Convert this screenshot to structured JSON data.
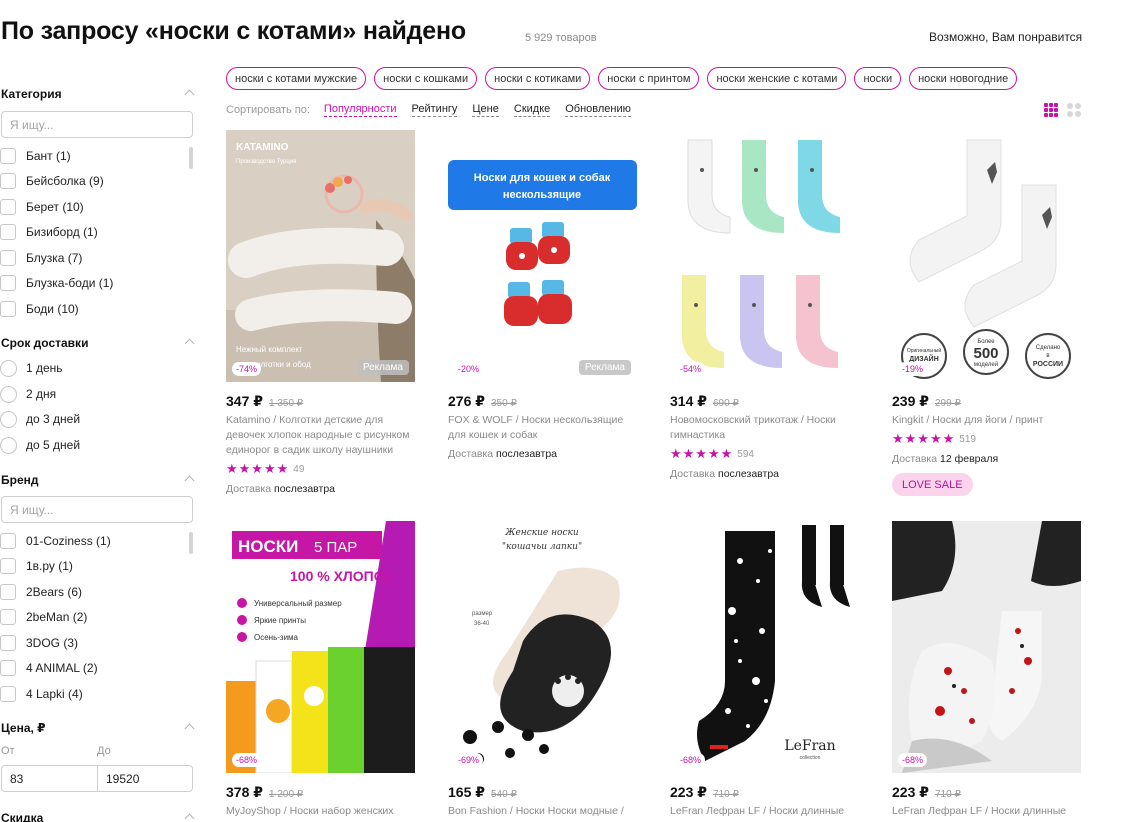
{
  "header": {
    "title": "По запросу «носки с котами» найдено",
    "count": "5 929 товаров",
    "maybe_like": "Возможно, Вам понравится"
  },
  "filters": {
    "category": {
      "title": "Категория",
      "placeholder": "Я ищу...",
      "items": [
        "Бант (1)",
        "Бейсболка (9)",
        "Берет (10)",
        "Бизиборд (1)",
        "Блузка (7)",
        "Блузка-боди (1)",
        "Боди (10)"
      ]
    },
    "delivery": {
      "title": "Срок доставки",
      "items": [
        "1 день",
        "2 дня",
        "до 3 дней",
        "до 5 дней"
      ]
    },
    "brand": {
      "title": "Бренд",
      "placeholder": "Я ищу...",
      "items": [
        "01-Coziness (1)",
        "1в.ру (1)",
        "2Bears (6)",
        "2beMan (2)",
        "3DOG (3)",
        "4 ANIMAL (2)",
        "4 Lapki (4)"
      ]
    },
    "price": {
      "title": "Цена, ₽",
      "from_label": "От",
      "to_label": "До",
      "from_value": "83",
      "to_value": "19520"
    },
    "discount": {
      "title": "Скидка"
    }
  },
  "tags": [
    "носки с котами мужские",
    "носки с кошками",
    "носки с котиками",
    "носки с принтом",
    "носки женские с котами",
    "носки",
    "носки новогодние"
  ],
  "sort": {
    "label": "Сортировать по:",
    "options": [
      "Популярности",
      "Рейтингу",
      "Цене",
      "Скидке",
      "Обновлению"
    ],
    "active": "Популярности"
  },
  "products": [
    {
      "price": "347 ₽",
      "old_price": "1 350 ₽",
      "discount": "-74%",
      "ad": "Реклама",
      "name": "Katamino / Колготки детские для девочек хлопок народные с рисунком единорог в садик школу наушники",
      "stars": "★★★★★",
      "reviews": "49",
      "delivery_label": "Доставка",
      "delivery": "послезавтра",
      "img_brand": "KATAMINO",
      "img_sub": "Производство Турция",
      "img_caption": "Нежный комплект\nвые колготки и обод"
    },
    {
      "price": "276 ₽",
      "old_price": "350 ₽",
      "discount": "-20%",
      "ad": "Реклама",
      "name": "FOX & WOLF / Носки нескользящие для кошек и собак",
      "delivery_label": "Доставка",
      "delivery": "послезавтра",
      "img_banner": "Носки для кошек и собак нескользящие"
    },
    {
      "price": "314 ₽",
      "old_price": "690 ₽",
      "discount": "-54%",
      "name": "Новомосковский трикотаж / Носки гимнастика",
      "stars": "★★★★★",
      "reviews": "594",
      "delivery_label": "Доставка",
      "delivery": "послезавтра"
    },
    {
      "price": "239 ₽",
      "old_price": "299 ₽",
      "discount": "-19%",
      "name": "Kingkit / Носки для йоги / принт",
      "stars": "★★★★★",
      "reviews": "519",
      "delivery_label": "Доставка",
      "delivery": "12 февраля",
      "badge": "LOVE SALE",
      "seal1": "Оригинальный ДИЗАЙН",
      "seal2": "Более 500 моделей",
      "seal3": "Сделано в РОССИИ"
    },
    {
      "price": "378 ₽",
      "old_price": "1 200 ₽",
      "discount": "-68%",
      "name": "MyJoyShop / Носки набор женских",
      "img_title": "НОСКИ",
      "img_title2": "5 ПАР",
      "img_sub": "100 % ХЛОПОК",
      "img_list": [
        "Универсальный размер",
        "Яркие принты",
        "Осень-зима"
      ]
    },
    {
      "price": "165 ₽",
      "old_price": "540 ₽",
      "discount": "-69%",
      "name": "Bon Fashion / Носки Носки модные /",
      "img_title": "Женские носки",
      "img_sub": "\"кошачьи лапки\"",
      "img_size": "размер 36-40"
    },
    {
      "price": "223 ₽",
      "old_price": "710 ₽",
      "discount": "-68%",
      "name": "LeFran Лефран LF / Носки длинные",
      "img_logo": "LeFran",
      "img_logo_sub": "collection"
    },
    {
      "price": "223 ₽",
      "old_price": "710 ₽",
      "discount": "-68%",
      "name": "LeFran Лефран LF / Носки длинные"
    }
  ],
  "colors": {
    "accent": "#cb11ab",
    "sale_bg": "#fcd3ec"
  }
}
